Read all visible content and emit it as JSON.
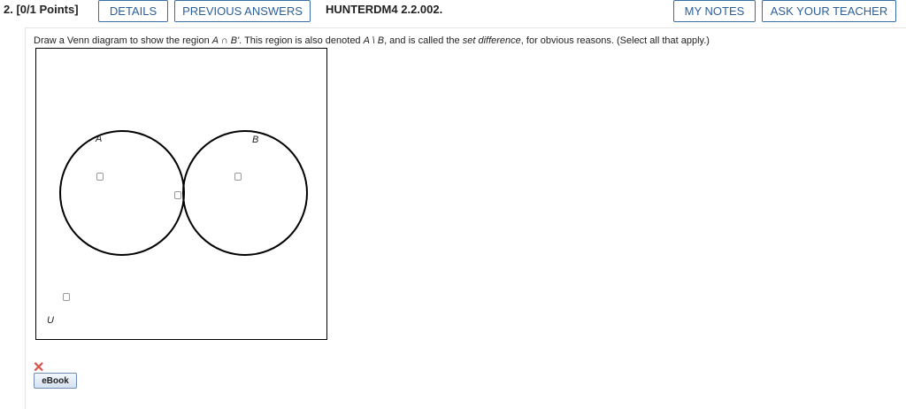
{
  "header": {
    "question_number": "2.",
    "points": "[0/1 Points]",
    "details_label": "DETAILS",
    "previous_answers_label": "PREVIOUS ANSWERS",
    "problem_code": "HUNTERDM4 2.2.002.",
    "my_notes_label": "MY NOTES",
    "ask_teacher_label": "ASK YOUR TEACHER"
  },
  "prompt": {
    "lead": "Draw a Venn diagram to show the region ",
    "expression": "A ∩ B'",
    "mid1": ". This region is also denoted ",
    "notation": "A \\ B",
    "mid2": ", and is called the ",
    "term": "set difference",
    "tail": ", for obvious reasons. (Select all that apply.)"
  },
  "venn": {
    "set_a_label": "A",
    "set_b_label": "B",
    "universe_label": "U",
    "regions": [
      {
        "name": "A only",
        "checked": false
      },
      {
        "name": "A and B",
        "checked": false
      },
      {
        "name": "B only",
        "checked": false
      },
      {
        "name": "outside",
        "checked": false
      }
    ]
  },
  "status": {
    "result_icon": "cross-icon",
    "result_color": "#d9534f"
  },
  "ebook_label": "eBook"
}
